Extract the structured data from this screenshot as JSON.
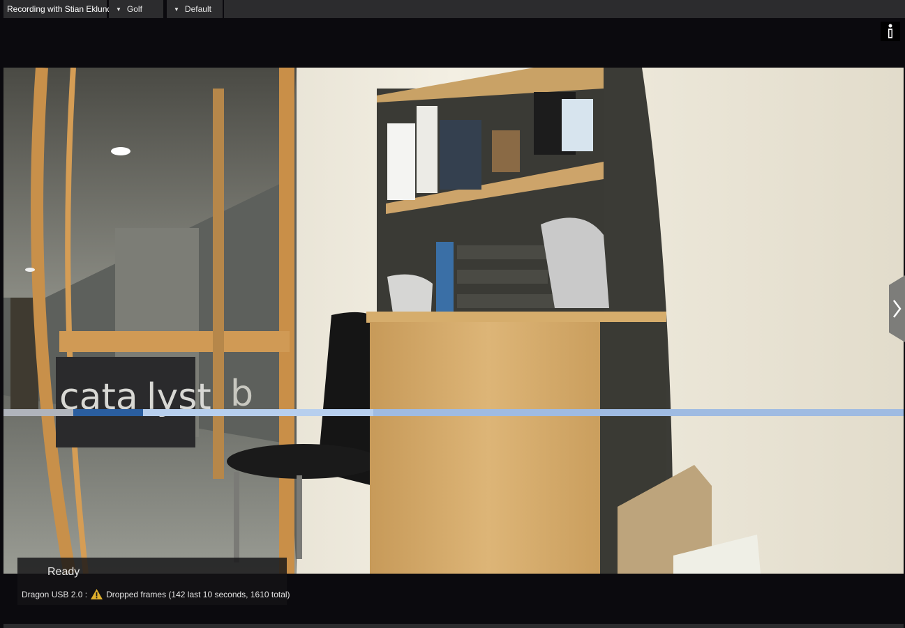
{
  "header": {
    "title": "Recording with Stian Eklund",
    "dropdowns": [
      {
        "label": "Golf"
      },
      {
        "label": "Default"
      }
    ],
    "info_icon": "info-icon"
  },
  "viewport": {
    "nav_icon": "chevron-right-icon"
  },
  "status": {
    "state": "Ready",
    "device": "Dragon USB 2.0 :",
    "warning_icon": "warning-icon",
    "message": "Dropped frames (142 last 10 seconds, 1610 total)"
  },
  "colors": {
    "bar": "#2c2c2e",
    "background": "#0b0a0e",
    "warning": "#e0b02c"
  }
}
